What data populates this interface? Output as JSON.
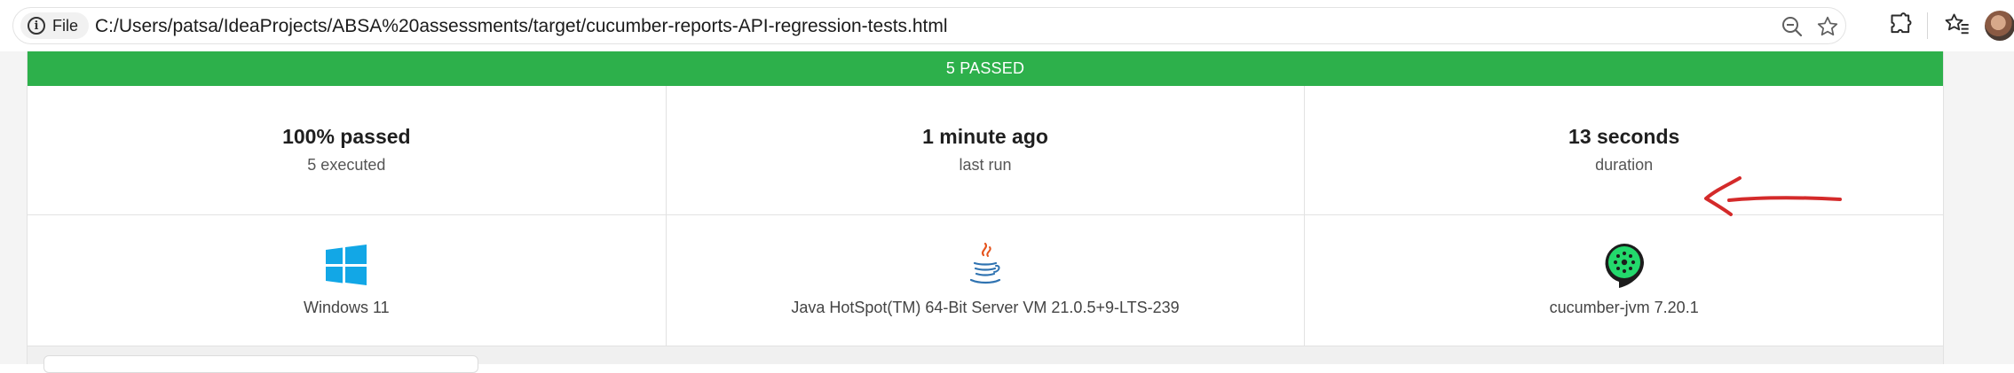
{
  "browser": {
    "file_chip_label": "File",
    "url": "C:/Users/patsa/IdeaProjects/ABSA%20assessments/target/cucumber-reports-API-regression-tests.html",
    "icons": [
      "info-icon",
      "zoom-out-icon",
      "star-icon",
      "extensions-icon",
      "favorites-icon",
      "avatar"
    ]
  },
  "report": {
    "status_banner": "5 PASSED",
    "status_color": "#2db04b",
    "stats": [
      {
        "value": "100% passed",
        "label": "5 executed"
      },
      {
        "value": "1 minute ago",
        "label": "last run"
      },
      {
        "value": "13 seconds",
        "label": "duration"
      }
    ],
    "environment": [
      {
        "icon": "windows-logo-icon",
        "label": "Windows 11"
      },
      {
        "icon": "java-logo-icon",
        "label": "Java HotSpot(TM) 64-Bit Server VM 21.0.5+9-LTS-239"
      },
      {
        "icon": "cucumber-logo-icon",
        "label": "cucumber-jvm 7.20.1"
      }
    ],
    "annotation": {
      "icon": "red-arrow-annotation",
      "color": "#d42a2a"
    }
  }
}
